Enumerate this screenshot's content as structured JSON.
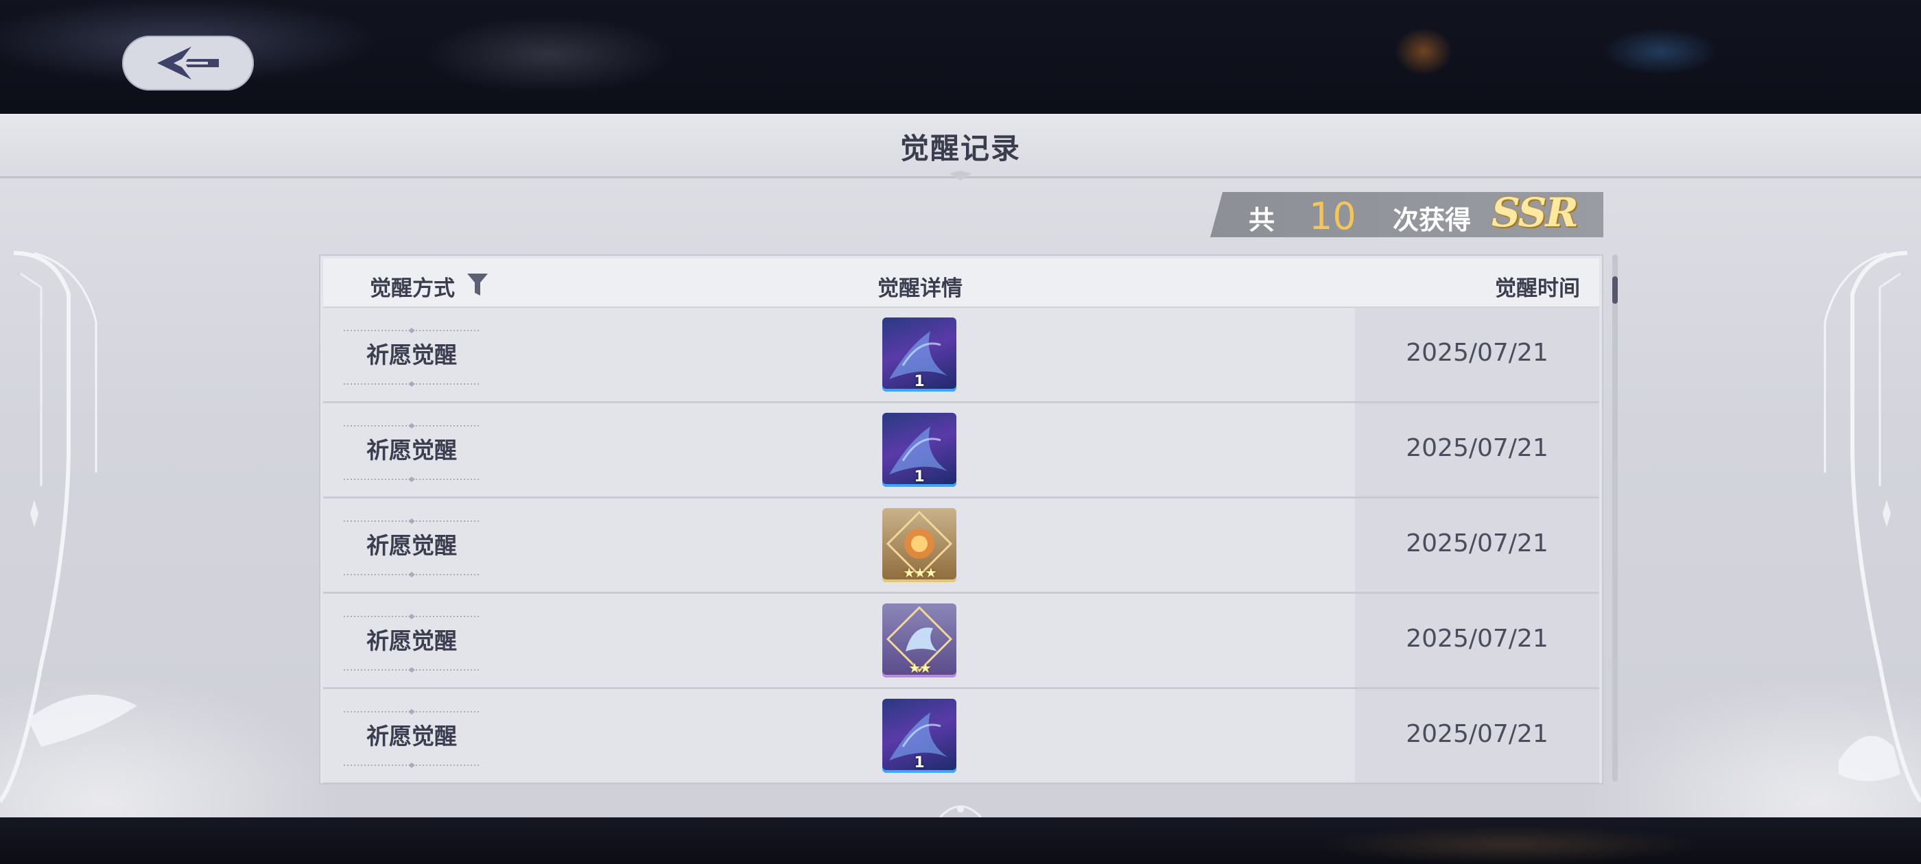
{
  "header": {
    "title": "觉醒记录"
  },
  "summary": {
    "prefix": "共",
    "count": "10",
    "suffix": "次获得",
    "badge": "SSR"
  },
  "table": {
    "columns": {
      "method": "觉醒方式",
      "detail": "觉醒详情",
      "time": "觉醒时间"
    },
    "rows": [
      {
        "method": "祈愿觉醒",
        "thumb_type": "card",
        "thumb_label": "1",
        "date": "2025/07/21"
      },
      {
        "method": "祈愿觉醒",
        "thumb_type": "card",
        "thumb_label": "1",
        "date": "2025/07/21"
      },
      {
        "method": "祈愿觉醒",
        "thumb_type": "gold",
        "thumb_label": "★★★",
        "date": "2025/07/21"
      },
      {
        "method": "祈愿觉醒",
        "thumb_type": "purple",
        "thumb_label": "★★",
        "date": "2025/07/21"
      },
      {
        "method": "祈愿觉醒",
        "thumb_type": "card",
        "thumb_label": "1",
        "date": "2025/07/21"
      }
    ]
  },
  "icons": {
    "back": "back-arrow-icon",
    "filter": "filter-icon"
  },
  "colors": {
    "accent_gold": "#f4c55a",
    "text_dark": "#3b3e4f",
    "panel": "#dcdde3"
  }
}
